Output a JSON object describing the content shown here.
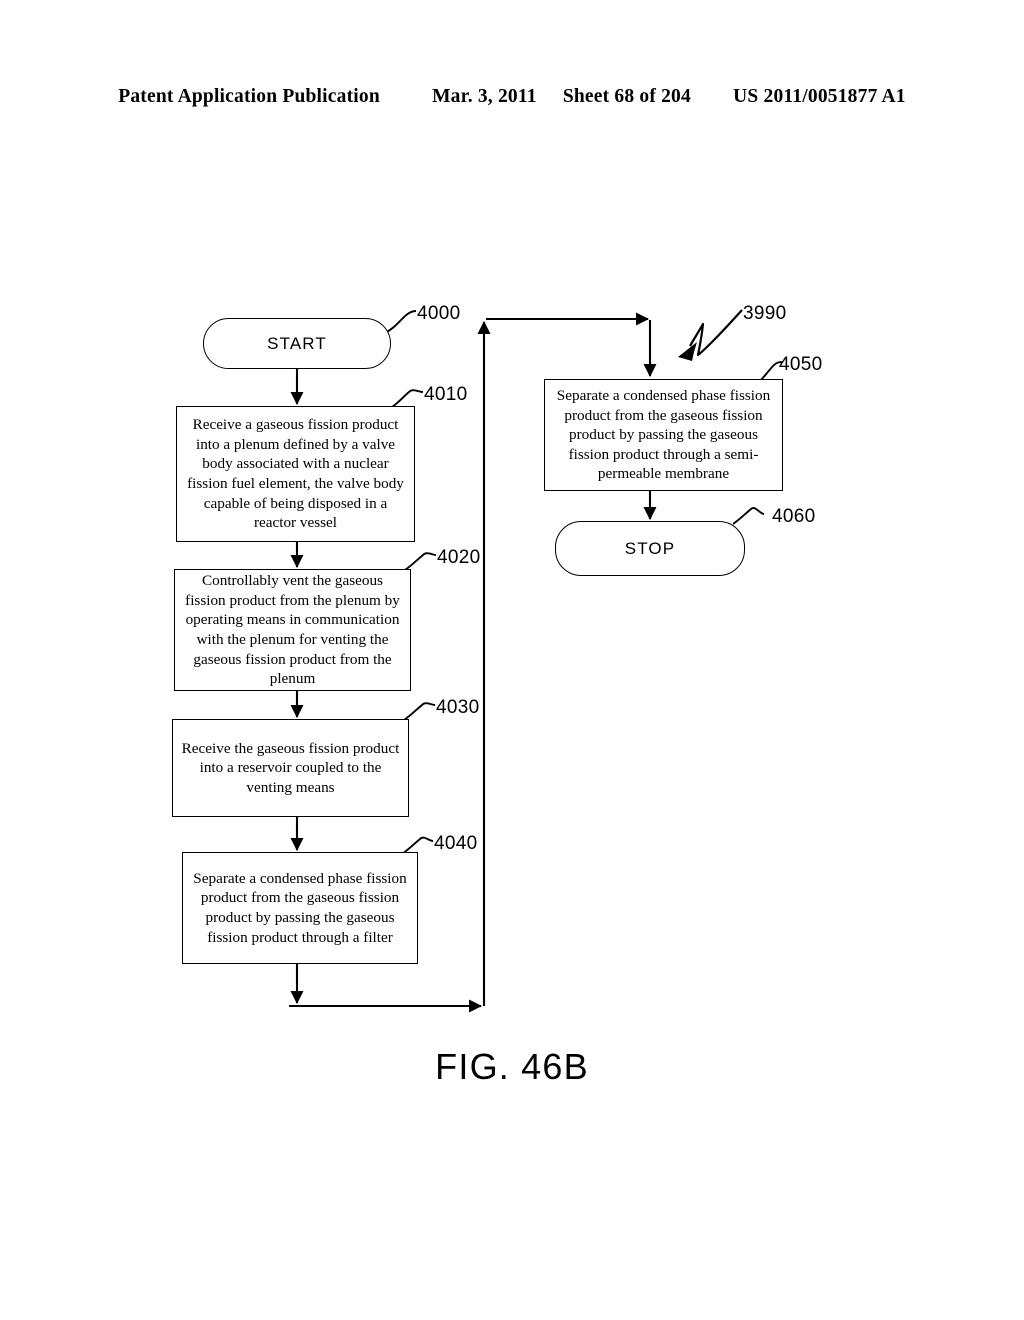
{
  "header": {
    "publication": "Patent Application Publication",
    "date": "Mar. 3, 2011",
    "sheet": "Sheet 68 of 204",
    "patent_number": "US 2011/0051877 A1"
  },
  "figure": {
    "caption": "FIG. 46B",
    "diagram_label": "3990"
  },
  "nodes": {
    "start": {
      "ref": "4000",
      "label": "START"
    },
    "step_4010": {
      "ref": "4010",
      "label": "Receive a gaseous fission product into a plenum defined by a valve body associated with a nuclear fission fuel element, the valve body capable of being disposed in a reactor vessel"
    },
    "step_4020": {
      "ref": "4020",
      "label": "Controllably vent the gaseous fission product from the plenum by operating means in communication with the plenum for venting the gaseous fission product from the plenum"
    },
    "step_4030": {
      "ref": "4030",
      "label": "Receive the gaseous fission product into a reservoir coupled to the venting means"
    },
    "step_4040": {
      "ref": "4040",
      "label": "Separate a condensed phase fission product from the gaseous fission product by passing the gaseous fission product through a filter"
    },
    "step_4050": {
      "ref": "4050",
      "label": "Separate a condensed phase fission product from the gaseous fission product by passing the gaseous fission product through a semi-permeable membrane"
    },
    "stop": {
      "ref": "4060",
      "label": "STOP"
    }
  },
  "colors": {
    "ink": "#000000",
    "paper": "#ffffff"
  }
}
